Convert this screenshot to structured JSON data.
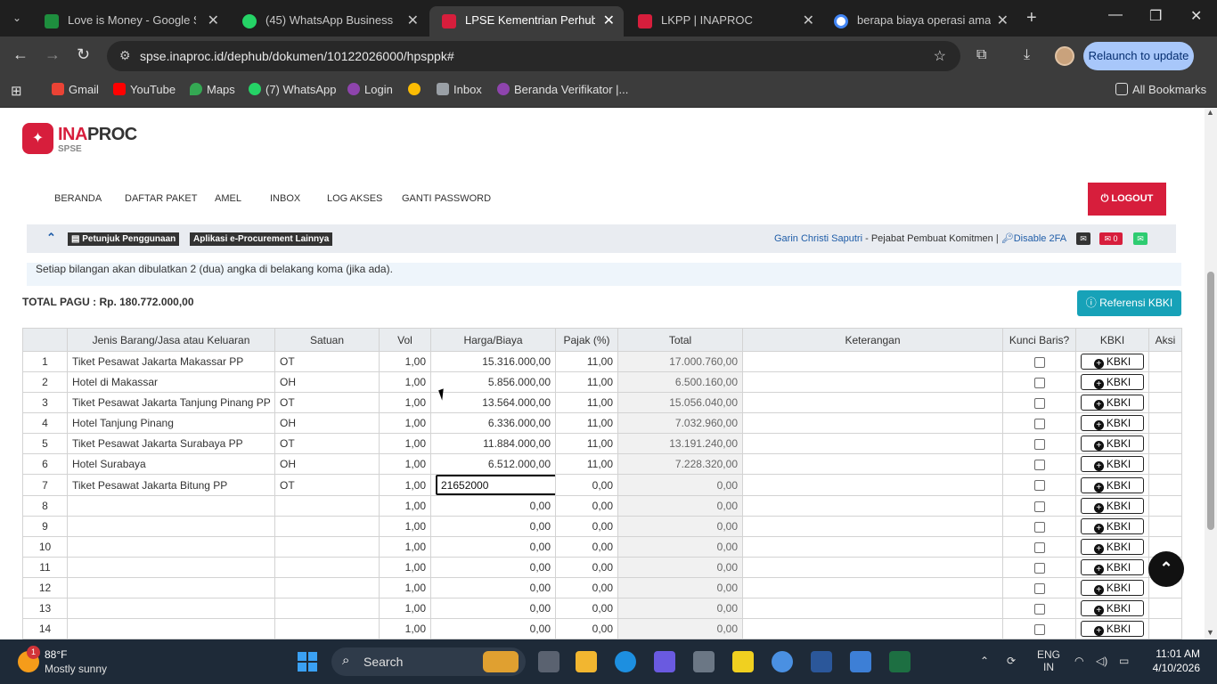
{
  "browser": {
    "tabs": [
      {
        "title": "Love is Money - Google Spre",
        "color": "#1e8e3e"
      },
      {
        "title": "(45) WhatsApp Business",
        "color": "#25d366"
      },
      {
        "title": "LPSE Kementrian Perhubung",
        "color": "#d71e3c"
      },
      {
        "title": "LKPP | INAPROC",
        "color": "#d71e3c"
      },
      {
        "title": "berapa biaya operasi amand",
        "color": "#4285f4"
      }
    ],
    "url": "spse.inaproc.id/dephub/dokumen/10122026000/hpsppk#",
    "relaunch_label": "Relaunch to update",
    "bookmarks": [
      "Gmail",
      "YouTube",
      "Maps",
      "(7) WhatsApp",
      "Login",
      "",
      "Inbox",
      "Beranda Verifikator |..."
    ],
    "all_bookmarks_label": "All Bookmarks"
  },
  "site": {
    "logo_text_red": "INA",
    "logo_text_dark": "PROC",
    "logo_sub": "SPSE",
    "nav": [
      "BERANDA",
      "DAFTAR PAKET",
      "AMEL",
      "INBOX",
      "LOG AKSES",
      "GANTI PASSWORD"
    ],
    "logout_label": "LOGOUT",
    "petunjuk_label": "Petunjuk Penggunaan",
    "aplikasi_label": "Aplikasi e-Procurement Lainnya",
    "user_name": "Garin Christi Saputri",
    "user_role": " - Pejabat Pembuat Komitmen | ",
    "disable_2fa": "Disable 2FA",
    "mail_count": "0",
    "brand_red": "#d71e3c"
  },
  "notice": "Setiap bilangan akan dibulatkan 2 (dua) angka di belakang koma (jika ada).",
  "total_pagu": "TOTAL PAGU : Rp. 180.772.000,00",
  "referensi_kbki_label": "Referensi KBKI",
  "table": {
    "headers": [
      "",
      "Jenis Barang/Jasa atau Keluaran",
      "Satuan",
      "Vol",
      "Harga/Biaya",
      "Pajak (%)",
      "Total",
      "Keterangan",
      "Kunci Baris?",
      "KBKI",
      "Aksi"
    ],
    "kbki_button_label": "KBKI",
    "rows": [
      {
        "no": "1",
        "item": "Tiket Pesawat Jakarta Makassar PP",
        "satuan": "OT",
        "vol": "1,00",
        "harga": "15.316.000,00",
        "pajak": "11,00",
        "total": "17.000.760,00"
      },
      {
        "no": "2",
        "item": "Hotel di Makassar",
        "satuan": "OH",
        "vol": "1,00",
        "harga": "5.856.000,00",
        "pajak": "11,00",
        "total": "6.500.160,00"
      },
      {
        "no": "3",
        "item": "Tiket Pesawat Jakarta Tanjung Pinang PP",
        "satuan": "OT",
        "vol": "1,00",
        "harga": "13.564.000,00",
        "pajak": "11,00",
        "total": "15.056.040,00"
      },
      {
        "no": "4",
        "item": "Hotel Tanjung Pinang",
        "satuan": "OH",
        "vol": "1,00",
        "harga": "6.336.000,00",
        "pajak": "11,00",
        "total": "7.032.960,00"
      },
      {
        "no": "5",
        "item": "Tiket Pesawat Jakarta Surabaya PP",
        "satuan": "OT",
        "vol": "1,00",
        "harga": "11.884.000,00",
        "pajak": "11,00",
        "total": "13.191.240,00"
      },
      {
        "no": "6",
        "item": "Hotel Surabaya",
        "satuan": "OH",
        "vol": "1,00",
        "harga": "6.512.000,00",
        "pajak": "11,00",
        "total": "7.228.320,00"
      },
      {
        "no": "7",
        "item": "Tiket Pesawat Jakarta Bitung PP",
        "satuan": "OT",
        "vol": "1,00",
        "harga": "21652000",
        "pajak": "0,00",
        "total": "0,00",
        "editing": true
      },
      {
        "no": "8",
        "item": "",
        "satuan": "",
        "vol": "1,00",
        "harga": "0,00",
        "pajak": "0,00",
        "total": "0,00"
      },
      {
        "no": "9",
        "item": "",
        "satuan": "",
        "vol": "1,00",
        "harga": "0,00",
        "pajak": "0,00",
        "total": "0,00"
      },
      {
        "no": "10",
        "item": "",
        "satuan": "",
        "vol": "1,00",
        "harga": "0,00",
        "pajak": "0,00",
        "total": "0,00"
      },
      {
        "no": "11",
        "item": "",
        "satuan": "",
        "vol": "1,00",
        "harga": "0,00",
        "pajak": "0,00",
        "total": "0,00"
      },
      {
        "no": "12",
        "item": "",
        "satuan": "",
        "vol": "1,00",
        "harga": "0,00",
        "pajak": "0,00",
        "total": "0,00"
      },
      {
        "no": "13",
        "item": "",
        "satuan": "",
        "vol": "1,00",
        "harga": "0,00",
        "pajak": "0,00",
        "total": "0,00"
      },
      {
        "no": "14",
        "item": "",
        "satuan": "",
        "vol": "1,00",
        "harga": "0,00",
        "pajak": "0,00",
        "total": "0,00"
      }
    ]
  },
  "taskbar": {
    "temp": "88°F",
    "condition": "Mostly sunny",
    "weather_badge": "1",
    "search_label": "Search",
    "lang_top": "ENG",
    "lang_bottom": "IN",
    "time": "11:01 AM",
    "date": "4/10/2026"
  }
}
